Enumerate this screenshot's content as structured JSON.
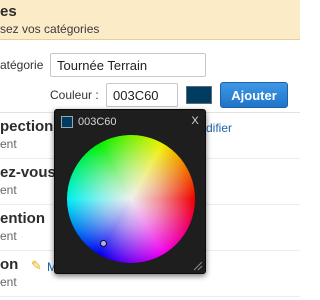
{
  "header": {
    "title": "es",
    "subtitle": "sez vos catégories"
  },
  "form": {
    "category_label": "atégorie",
    "category_value": "Tournée Terrain",
    "color_label": "Couleur :",
    "color_value": "003C60",
    "swatch_color": "#003C60",
    "add_button": "Ajouter"
  },
  "categories": [
    {
      "title": "pection T",
      "subtitle": "ent",
      "edit_label": "difier"
    },
    {
      "title": "ez-vous",
      "subtitle": "ent"
    },
    {
      "title": "ention",
      "subtitle": "ent"
    },
    {
      "title": "on",
      "subtitle": "ent",
      "edit_label": "M"
    }
  ],
  "color_picker": {
    "hex_label": "003C60",
    "close_label": "X",
    "swatch_color": "#003C60"
  },
  "colors": {
    "accent": "#1F74C9",
    "banner": "#FCEBC7",
    "link": "#1B63A9",
    "picker_bg": "#1E1E1E"
  }
}
